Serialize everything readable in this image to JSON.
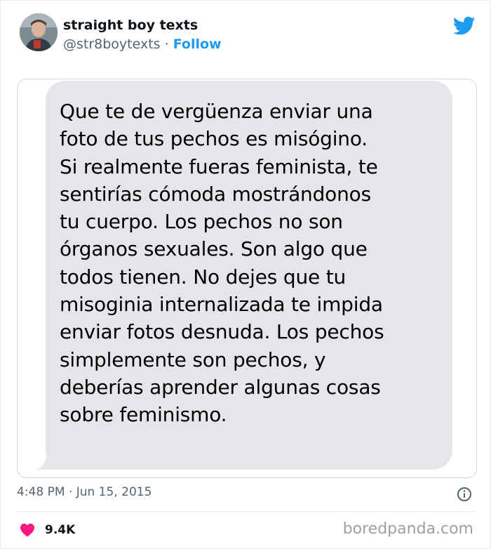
{
  "author": {
    "display_name": "straight boy texts",
    "handle": "@str8boytexts",
    "separator": "·",
    "follow_label": "Follow"
  },
  "message": {
    "lines": [
      "Que te de vergüenza enviar una",
      "foto de tus pechos es misógino.",
      "Si realmente fueras feminista, te",
      "sentirías cómoda mostrándonos",
      "tu cuerpo. Los pechos no son",
      "órganos sexuales. Son algo que",
      "todos tienen. No dejes que tu",
      "misoginia internalizada te impida",
      "enviar fotos desnuda. Los pechos",
      "simplemente son pechos, y",
      "deberías aprender algunas cosas",
      "sobre feminismo."
    ]
  },
  "meta": {
    "time": "4:48 PM",
    "separator": "·",
    "date": "Jun 15, 2015"
  },
  "engagement": {
    "likes": "9.4K"
  },
  "watermark": "boredpanda.com",
  "colors": {
    "twitter_blue": "#1d9bf0",
    "bubble_gray": "#e5e5ea",
    "heart_red": "#f91880",
    "muted_text": "#536471"
  },
  "icons": {
    "logo": "twitter-bird-icon",
    "info": "info-circle-icon",
    "like": "heart-icon"
  }
}
